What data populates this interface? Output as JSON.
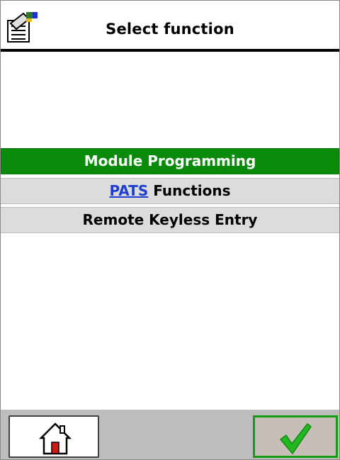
{
  "header": {
    "title": "Select function",
    "icon": "module-config-icon"
  },
  "menu": {
    "items": [
      {
        "label": "Module Programming",
        "selected": true
      },
      {
        "link_text": "PATS",
        "label_suffix": " Functions",
        "selected": false
      },
      {
        "label": "Remote Keyless Entry",
        "selected": false
      }
    ]
  },
  "footer": {
    "home_icon": "home-icon",
    "confirm_icon": "checkmark-icon"
  },
  "colors": {
    "selected_row": "#0a8a0a",
    "row_background": "#dcdcdc",
    "link": "#1f3fd0",
    "footer_background": "#bdbdbd",
    "confirm_border": "#169b16",
    "check": "#22b822"
  }
}
